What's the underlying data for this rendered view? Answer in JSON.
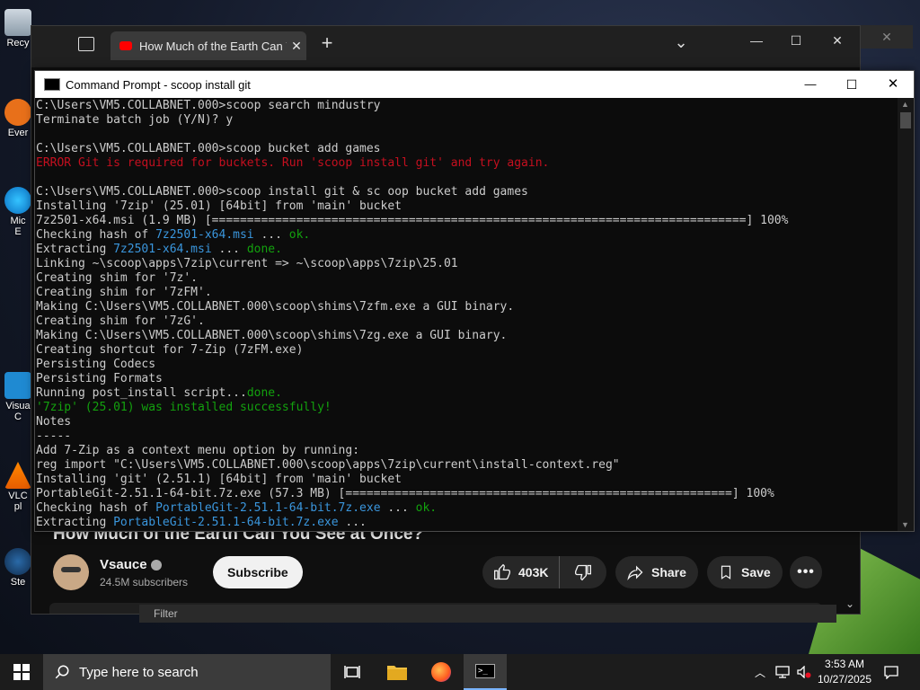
{
  "desktop": {
    "icons": [
      {
        "label": "Recy"
      },
      {
        "label": "Ever"
      },
      {
        "label": "Mic"
      },
      {
        "label": "E"
      },
      {
        "label": "Visua"
      },
      {
        "label": "C"
      },
      {
        "label": "VLC"
      },
      {
        "label": "pl"
      },
      {
        "label": "Ste"
      }
    ]
  },
  "browser": {
    "tab_title": "How Much of the Earth Can Yo",
    "tab_close": "✕",
    "new_tab": "+",
    "minimize": "—",
    "maximize": "☐",
    "close": "✕",
    "video_title": "How Much of the Earth Can You See at Once?",
    "channel_name": "Vsauce",
    "subscribers": "24.5M subscribers",
    "subscribe_label": "Subscribe",
    "likes": "403K",
    "share_label": "Share",
    "save_label": "Save",
    "filter_text": "Filter"
  },
  "cmd": {
    "title": "Command Prompt - scoop  install git",
    "minimize": "—",
    "maximize": "☐",
    "close": "✕",
    "lines": {
      "l1": "C:\\Users\\VM5.COLLABNET.000>scoop search mindustry",
      "l2": "Terminate batch job (Y/N)? y",
      "l3": "",
      "l4": "C:\\Users\\VM5.COLLABNET.000>scoop bucket add games",
      "l5": "ERROR Git is required for buckets. Run 'scoop install git' and try again.",
      "l6": "",
      "l7": "C:\\Users\\VM5.COLLABNET.000>scoop install git & sc oop bucket add games",
      "l8": "Installing '7zip' (25.01) [64bit] from 'main' bucket",
      "l9": "7z2501-x64.msi (1.9 MB) [============================================================================] 100%",
      "l10a": "Checking hash of ",
      "l10b": "7z2501-x64.msi",
      "l10c": " ... ",
      "l10d": "ok.",
      "l11a": "Extracting ",
      "l11b": "7z2501-x64.msi",
      "l11c": " ... ",
      "l11d": "done.",
      "l12": "Linking ~\\scoop\\apps\\7zip\\current => ~\\scoop\\apps\\7zip\\25.01",
      "l13": "Creating shim for '7z'.",
      "l14": "Creating shim for '7zFM'.",
      "l15": "Making C:\\Users\\VM5.COLLABNET.000\\scoop\\shims\\7zfm.exe a GUI binary.",
      "l16": "Creating shim for '7zG'.",
      "l17": "Making C:\\Users\\VM5.COLLABNET.000\\scoop\\shims\\7zg.exe a GUI binary.",
      "l18": "Creating shortcut for 7-Zip (7zFM.exe)",
      "l19": "Persisting Codecs",
      "l20": "Persisting Formats",
      "l21a": "Running post_install script...",
      "l21b": "done.",
      "l22": "'7zip' (25.01) was installed successfully!",
      "l23": "Notes",
      "l24": "-----",
      "l25": "Add 7-Zip as a context menu option by running:",
      "l26": "reg import \"C:\\Users\\VM5.COLLABNET.000\\scoop\\apps\\7zip\\current\\install-context.reg\"",
      "l27": "Installing 'git' (2.51.1) [64bit] from 'main' bucket",
      "l28": "PortableGit-2.51.1-64-bit.7z.exe (57.3 MB) [=======================================================] 100%",
      "l29a": "Checking hash of ",
      "l29b": "PortableGit-2.51.1-64-bit.7z.exe",
      "l29c": " ... ",
      "l29d": "ok.",
      "l30a": "Extracting ",
      "l30b": "PortableGit-2.51.1-64-bit.7z.exe",
      "l30c": " ..."
    }
  },
  "taskbar": {
    "search_placeholder": "Type here to search",
    "time": "3:53 AM",
    "date": "10/27/2025"
  },
  "colors": {
    "error": "#c50f1f",
    "success": "#13a10e",
    "highlight": "#3a96dd",
    "terminal_text": "#cccccc"
  }
}
